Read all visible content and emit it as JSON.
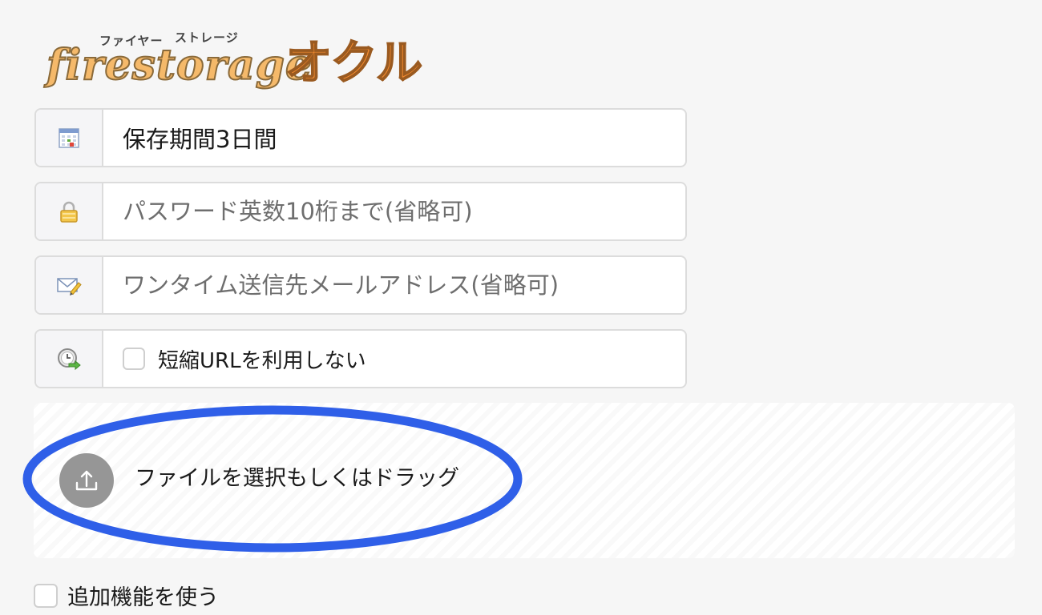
{
  "logo": {
    "ruby_firestorage": "ファイヤー",
    "ruby_storage": "ストレージ",
    "name_en": "firestorage",
    "name_jp": "オクル"
  },
  "form": {
    "retention": {
      "icon": "calendar-icon",
      "value": "保存期間3日間"
    },
    "password": {
      "icon": "lock-icon",
      "placeholder": "パスワード英数10桁まで(省略可)"
    },
    "onetime_email": {
      "icon": "mail-pen-icon",
      "placeholder": "ワンタイム送信先メールアドレス(省略可)"
    },
    "short_url": {
      "icon": "clock-arrow-icon",
      "label": "短縮URLを利用しない",
      "checked": false
    }
  },
  "upload": {
    "icon": "upload-icon",
    "label": "ファイルを選択もしくはドラッグ"
  },
  "extra_features": {
    "label": "追加機能を使う",
    "checked": false
  },
  "colors": {
    "highlight_ellipse": "#2f5fe8",
    "upload_button": "#969696",
    "logo_en": "#f5b96a",
    "logo_jp": "#f28a2f"
  }
}
